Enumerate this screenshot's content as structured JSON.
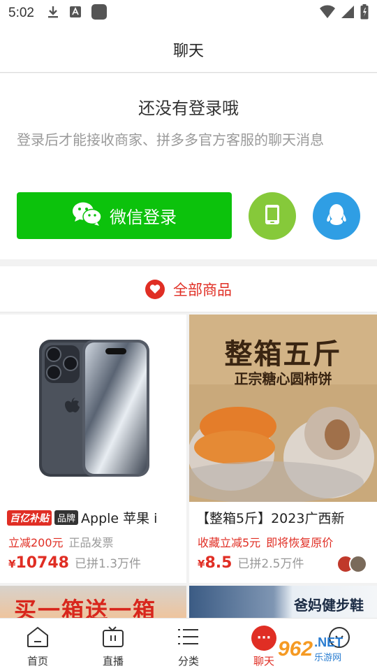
{
  "status_bar": {
    "time": "5:02"
  },
  "header": {
    "title": "聊天"
  },
  "login": {
    "headline": "还没有登录哦",
    "subtext": "登录后才能接收商家、拼多多官方客服的聊天消息",
    "wechat_button": "微信登录"
  },
  "goods": {
    "section_title": "全部商品",
    "items": [
      {
        "subsidy_tag": "百亿补贴",
        "brand_tag": "品牌",
        "title": "Apple 苹果 i",
        "promo": "立减200元",
        "promo_extra": "正品发票",
        "price_symbol": "¥",
        "price": "10748",
        "sold": "已拼1.3万件"
      },
      {
        "title": "【整箱5斤】2023广西新",
        "promo": "收藏立减5元",
        "promo_extra": "即将恢复原价",
        "price_symbol": "¥",
        "price": "8.5",
        "sold": "已拼2.5万件",
        "image_text_top": "整箱五斤",
        "image_text_sub": "正宗糖心圆柿饼"
      }
    ],
    "partial_items": [
      {
        "image_text": "买一箱送一箱"
      },
      {
        "image_text": "爸妈健步鞋"
      }
    ]
  },
  "bottom_nav": {
    "items": [
      {
        "label": "首页",
        "icon": "home-icon"
      },
      {
        "label": "直播",
        "icon": "tv-icon"
      },
      {
        "label": "分类",
        "icon": "list-icon"
      },
      {
        "label": "聊天",
        "icon": "chat-icon",
        "active": true
      },
      {
        "label": "",
        "icon": "profile-icon"
      }
    ]
  },
  "watermark": {
    "number": "962",
    "domain": ".NET",
    "cn": "乐游网"
  },
  "colors": {
    "accent": "#e02e24",
    "wechat": "#0cc20c",
    "phone": "#86c93a",
    "qq": "#2f9ee4"
  }
}
